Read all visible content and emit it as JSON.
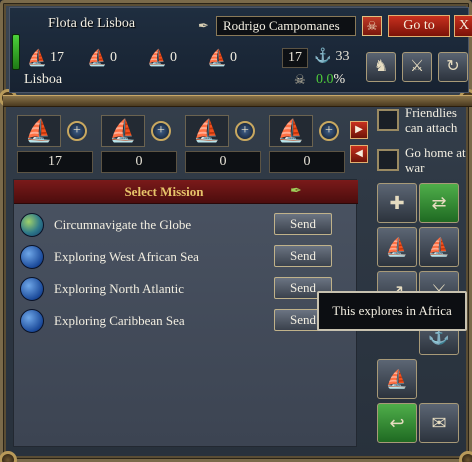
{
  "header": {
    "fleet_name": "Flota de Lisboa",
    "leader_name": "Rodrigo Campomanes",
    "goto_label": "Go to",
    "close_label": "X",
    "ships": [
      {
        "icon": "heavy-ship-icon",
        "value": "17"
      },
      {
        "icon": "light-ship-icon",
        "value": "0"
      },
      {
        "icon": "galley-icon",
        "value": "0"
      },
      {
        "icon": "transport-icon",
        "value": "0"
      }
    ],
    "total_ships": "17",
    "morale_value": "33",
    "location": "Lisboa",
    "attrition_value": "0.0",
    "attrition_unit": "%"
  },
  "units": [
    {
      "icon": "heavy-ship-icon",
      "count": "17"
    },
    {
      "icon": "light-ship-icon",
      "count": "0"
    },
    {
      "icon": "galley-icon",
      "count": "0"
    },
    {
      "icon": "transport-icon",
      "count": "0"
    }
  ],
  "options": {
    "friendlies_label": "Friendlies can attach",
    "go_home_label": "Go home at war"
  },
  "missions": {
    "title": "Select Mission",
    "send_label": "Send",
    "items": [
      {
        "label": "Circumnavigate the Globe",
        "icon": "globe-icon"
      },
      {
        "label": "Exploring West African Sea",
        "icon": "globe-icon"
      },
      {
        "label": "Exploring North Atlantic",
        "icon": "globe-icon"
      },
      {
        "label": "Exploring Caribbean Sea",
        "icon": "globe-icon"
      }
    ]
  },
  "tooltip": {
    "text": "This explores in Africa"
  },
  "colors": {
    "accent_red": "#c8301e",
    "attrition_green": "#4ecb3a",
    "mission_title": "#e6c46a"
  }
}
